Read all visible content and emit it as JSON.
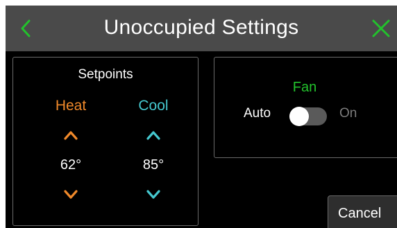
{
  "header": {
    "title": "Unoccupied Settings",
    "back_icon": "chevron-left-icon",
    "close_icon": "close-icon",
    "icon_color": "#22c22c",
    "background": "#4a4a4a"
  },
  "setpoints": {
    "title": "Setpoints",
    "heat": {
      "label": "Heat",
      "value": "62°",
      "color": "#f0892a",
      "up_icon": "chevron-up-icon",
      "down_icon": "chevron-down-icon"
    },
    "cool": {
      "label": "Cool",
      "value": "85°",
      "color": "#45c8cf",
      "up_icon": "chevron-up-icon",
      "down_icon": "chevron-down-icon"
    }
  },
  "fan": {
    "title": "Fan",
    "title_color": "#22c22c",
    "off_label": "Auto",
    "on_label": "On",
    "state": "Auto"
  },
  "actions": {
    "cancel_label": "Cancel"
  }
}
